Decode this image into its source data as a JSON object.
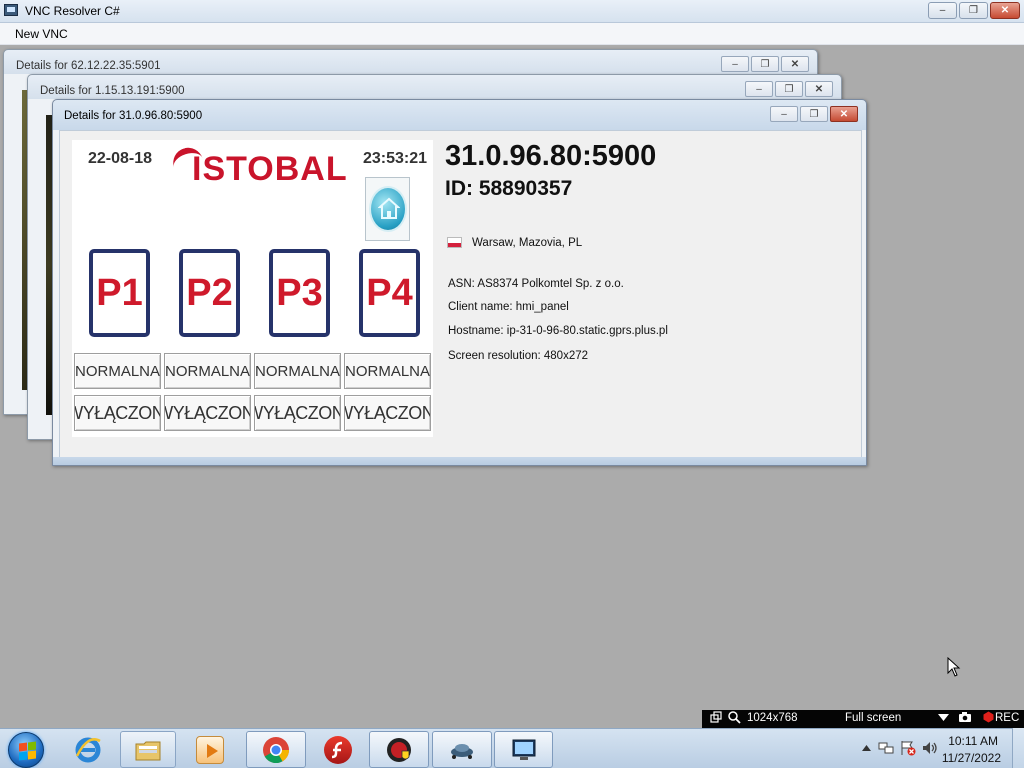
{
  "app": {
    "title": "VNC Resolver C#",
    "menu": [
      "New VNC"
    ],
    "caption_buttons": {
      "minimize": "–",
      "maximize": "❐",
      "close": "✕"
    }
  },
  "windows": [
    {
      "title": "Details for 62.12.22.35:5901",
      "active": false
    },
    {
      "title": "Details for 1.15.13.191:5900",
      "active": false
    },
    {
      "title": "Details for 31.0.96.80:5900",
      "active": true
    }
  ],
  "details": {
    "address": "31.0.96.80:5900",
    "id": "ID: 58890357",
    "flag_country": "PL",
    "location": "Warsaw, Mazovia, PL",
    "asn": "ASN: AS8374 Polkomtel Sp. z o.o.",
    "client_name": "Client name: hmi_panel",
    "hostname": "Hostname: ip-31-0-96-80.static.gprs.plus.pl",
    "screen_resolution": "Screen resolution: 480x272"
  },
  "hmi": {
    "date": "22-08-18",
    "time": "23:53:21",
    "logo": "ISTOBAL",
    "brand_color": "#c9142b",
    "programs": [
      "P1",
      "P2",
      "P3",
      "P4"
    ],
    "mode_row_1": [
      "NORMALNA",
      "NORMALNA",
      "NORMALNA",
      "NORMALNA"
    ],
    "mode_row_2": [
      "WYŁĄCZONI",
      "WYŁĄCZONI",
      "WYŁĄCZONI",
      "WYŁĄCZONI"
    ]
  },
  "recorder": {
    "resolution": "1024x768",
    "mode": "Full screen",
    "rec_label": "REC"
  },
  "taskbar": {
    "pinned": [
      "internet-explorer",
      "file-explorer",
      "media-player",
      "chrome",
      "flash",
      "app-shield"
    ],
    "running": [
      "network-app",
      "vnc-resolver"
    ],
    "clock_time": "10:11 AM",
    "clock_date": "11/27/2022"
  }
}
